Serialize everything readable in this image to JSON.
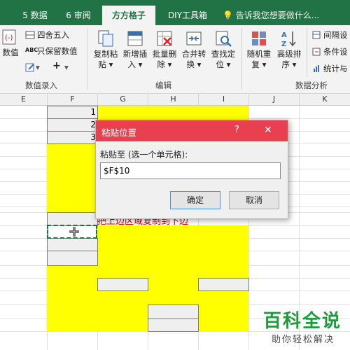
{
  "tabs": [
    {
      "label": "5 数据"
    },
    {
      "label": "6 审阅"
    },
    {
      "label": "方方格子"
    },
    {
      "label": "DIY工具箱"
    }
  ],
  "tell_me": "告诉我您想要做什么...",
  "ribbon": {
    "left_partial": {
      "top_label": "数值",
      "group_label": "数值录入"
    },
    "small": {
      "round": "四舍五入",
      "keep_value": "只保留数值",
      "abc": "ABC",
      "plus": "+",
      "minus": "-"
    },
    "editing": {
      "buttons": [
        {
          "label1": "复制粘",
          "label2": "贴"
        },
        {
          "label1": "新增插",
          "label2": "入"
        },
        {
          "label1": "批量删",
          "label2": "除"
        },
        {
          "label1": "合并转",
          "label2": "换"
        },
        {
          "label1": "查找定",
          "label2": "位"
        }
      ],
      "group_label": "编辑"
    },
    "analysis": {
      "buttons": [
        {
          "label1": "随机重",
          "label2": "复"
        },
        {
          "label1": "高级排",
          "label2": "序"
        }
      ],
      "side": [
        "间隔设",
        "条件设",
        "统计与"
      ],
      "group_label": "数据分析"
    }
  },
  "columns": [
    "E",
    "F",
    "G",
    "H",
    "I",
    "J",
    "K"
  ],
  "cells": {
    "f1": "1",
    "f2": "2",
    "f3": "3",
    "red_note": "把上边区域复制到下边"
  },
  "dialog": {
    "title": "粘贴位置",
    "help": "?",
    "close": "✕",
    "prompt": "粘贴至 (选一个单元格):",
    "value": "$F$10",
    "ok": "确定",
    "cancel": "取消"
  },
  "watermark": {
    "main": "百科全说",
    "sub": "助你轻松解决"
  },
  "colors": {
    "excel_green": "#217346",
    "dialog_red": "#e8404f",
    "cell_yellow": "#ffff00",
    "note_red": "#cc0000"
  }
}
